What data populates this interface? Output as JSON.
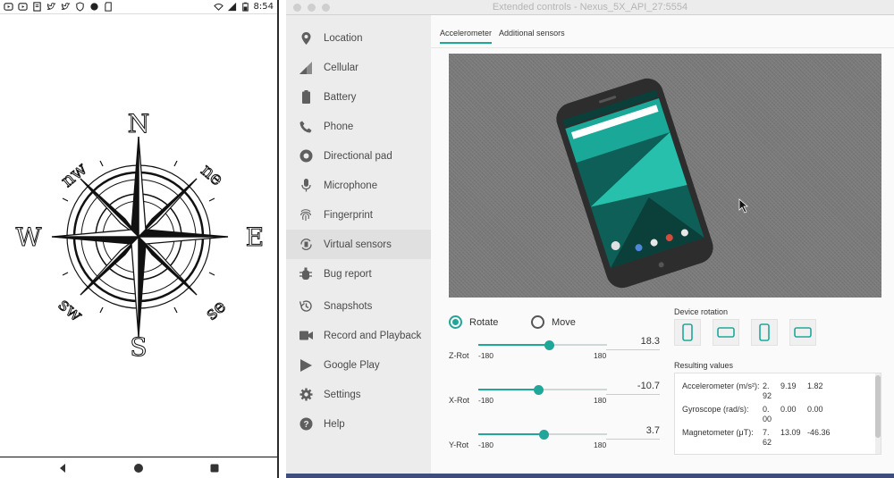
{
  "phone": {
    "status_time": "8:54",
    "compass": {
      "north": "N",
      "south": "S",
      "east": "E",
      "west": "W",
      "ne": "ne",
      "nw": "nw",
      "se": "se",
      "sw": "sw"
    }
  },
  "window": {
    "title": "Extended controls - Nexus_5X_API_27:5554"
  },
  "sidebar": {
    "items": [
      {
        "label": "Location",
        "icon": "location-pin-icon"
      },
      {
        "label": "Cellular",
        "icon": "signal-icon"
      },
      {
        "label": "Battery",
        "icon": "battery-icon"
      },
      {
        "label": "Phone",
        "icon": "phone-icon"
      },
      {
        "label": "Directional pad",
        "icon": "dpad-icon"
      },
      {
        "label": "Microphone",
        "icon": "microphone-icon"
      },
      {
        "label": "Fingerprint",
        "icon": "fingerprint-icon"
      },
      {
        "label": "Virtual sensors",
        "icon": "rotate-icon"
      },
      {
        "label": "Bug report",
        "icon": "bug-icon"
      },
      {
        "label": "Snapshots",
        "icon": "history-icon"
      },
      {
        "label": "Record and Playback",
        "icon": "video-icon"
      },
      {
        "label": "Google Play",
        "icon": "play-store-icon"
      },
      {
        "label": "Settings",
        "icon": "gear-icon"
      },
      {
        "label": "Help",
        "icon": "help-icon"
      }
    ],
    "active_index": 7
  },
  "tabs": {
    "accelerometer": "Accelerometer",
    "additional": "Additional sensors"
  },
  "mode": {
    "rotate": "Rotate",
    "move": "Move",
    "selected": "rotate"
  },
  "sliders": [
    {
      "label": "Z-Rot",
      "min": "-180",
      "max": "180",
      "value": "18.3",
      "numeric": 18.3
    },
    {
      "label": "X-Rot",
      "min": "-180",
      "max": "180",
      "value": "-10.7",
      "numeric": -10.7
    },
    {
      "label": "Y-Rot",
      "min": "-180",
      "max": "180",
      "value": "3.7",
      "numeric": 3.7
    }
  ],
  "device_rotation": {
    "title": "Device rotation"
  },
  "results": {
    "title": "Resulting values",
    "rows": [
      {
        "name": "Accelerometer (m/s²):",
        "v1a": "2.",
        "v1b": "92",
        "v2": "9.19",
        "v3": "1.82"
      },
      {
        "name": "Gyroscope (rad/s):",
        "v1a": "0.",
        "v1b": "00",
        "v2": "0.00",
        "v3": "0.00"
      },
      {
        "name": "Magnetometer (μT):",
        "v1a": "7.",
        "v1b": "62",
        "v2": "13.09",
        "v3": "-46.36"
      }
    ]
  },
  "colors": {
    "accent": "#1fa89a",
    "sidebar_bg": "#ececec",
    "viewport_bg": "#7a7a7a"
  }
}
